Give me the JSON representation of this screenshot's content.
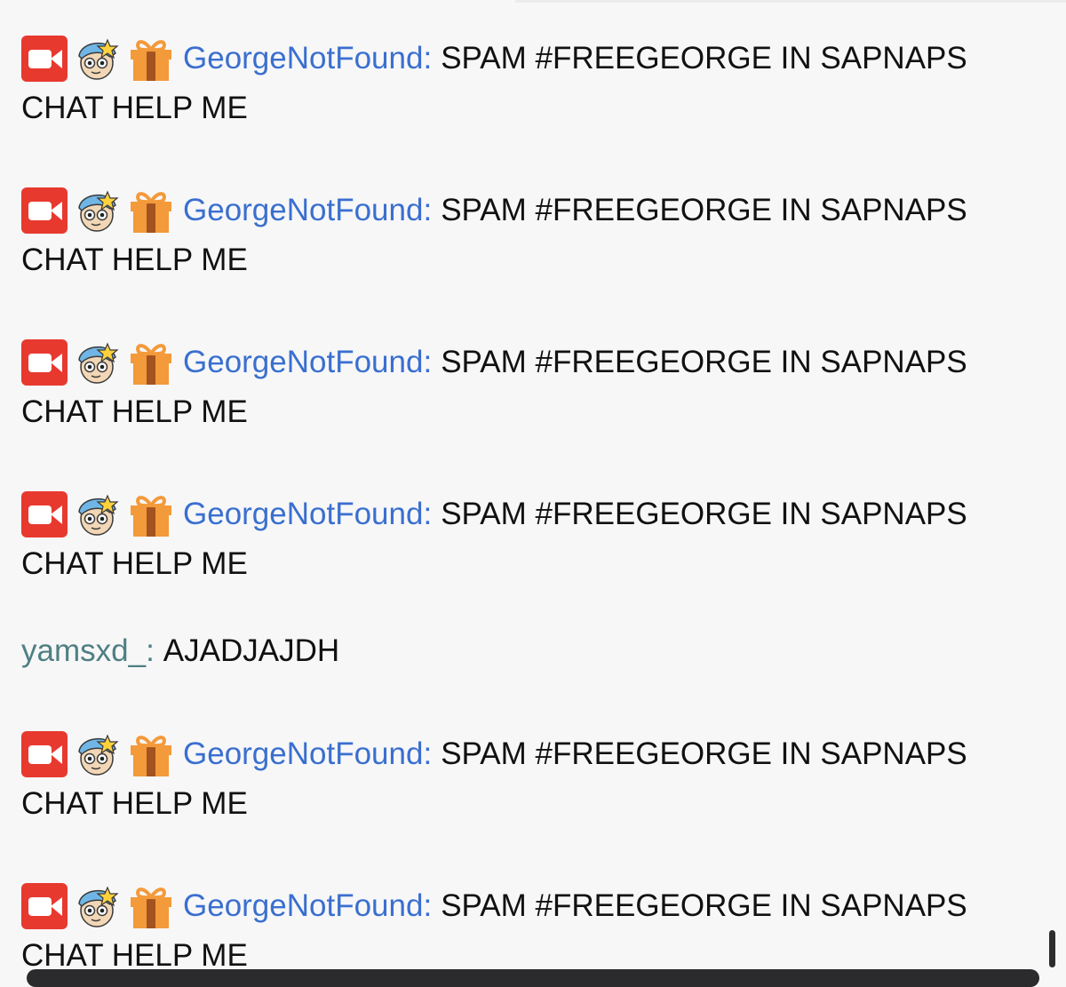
{
  "chat": {
    "messages": [
      {
        "user": "GeorgeNotFound",
        "sep": ":",
        "text1": "SPAM #FREEGEORGE IN SAPNAPS",
        "text2": "CHAT HELP ME"
      },
      {
        "user": "GeorgeNotFound",
        "sep": ":",
        "text1": "SPAM #FREEGEORGE IN SAPNAPS",
        "text2": "CHAT HELP ME"
      },
      {
        "user": "GeorgeNotFound",
        "sep": ":",
        "text1": "SPAM #FREEGEORGE IN SAPNAPS",
        "text2": "CHAT HELP ME"
      },
      {
        "user": "GeorgeNotFound",
        "sep": ":",
        "text1": "SPAM #FREEGEORGE IN SAPNAPS",
        "text2": "CHAT HELP ME"
      },
      {
        "user": "yamsxd_",
        "sep": ":",
        "text1": "AJADJAJDH"
      },
      {
        "user": "GeorgeNotFound",
        "sep": ":",
        "text1": "SPAM #FREEGEORGE IN SAPNAPS",
        "text2": "CHAT HELP ME"
      },
      {
        "user": "GeorgeNotFound",
        "sep": ":",
        "text1": "SPAM #FREEGEORGE IN SAPNAPS",
        "text2": "CHAT HELP ME"
      }
    ]
  },
  "badges": [
    "video-camera-badge-icon",
    "police-officer-badge-icon",
    "gift-sub-badge-icon"
  ],
  "colors": {
    "background": "#f7f7f8",
    "username_george": "#3a6fcf",
    "username_yams": "#4f7f83",
    "text": "#111111",
    "camera_badge": "#e8392f",
    "gift_badge": "#f39a3b"
  }
}
